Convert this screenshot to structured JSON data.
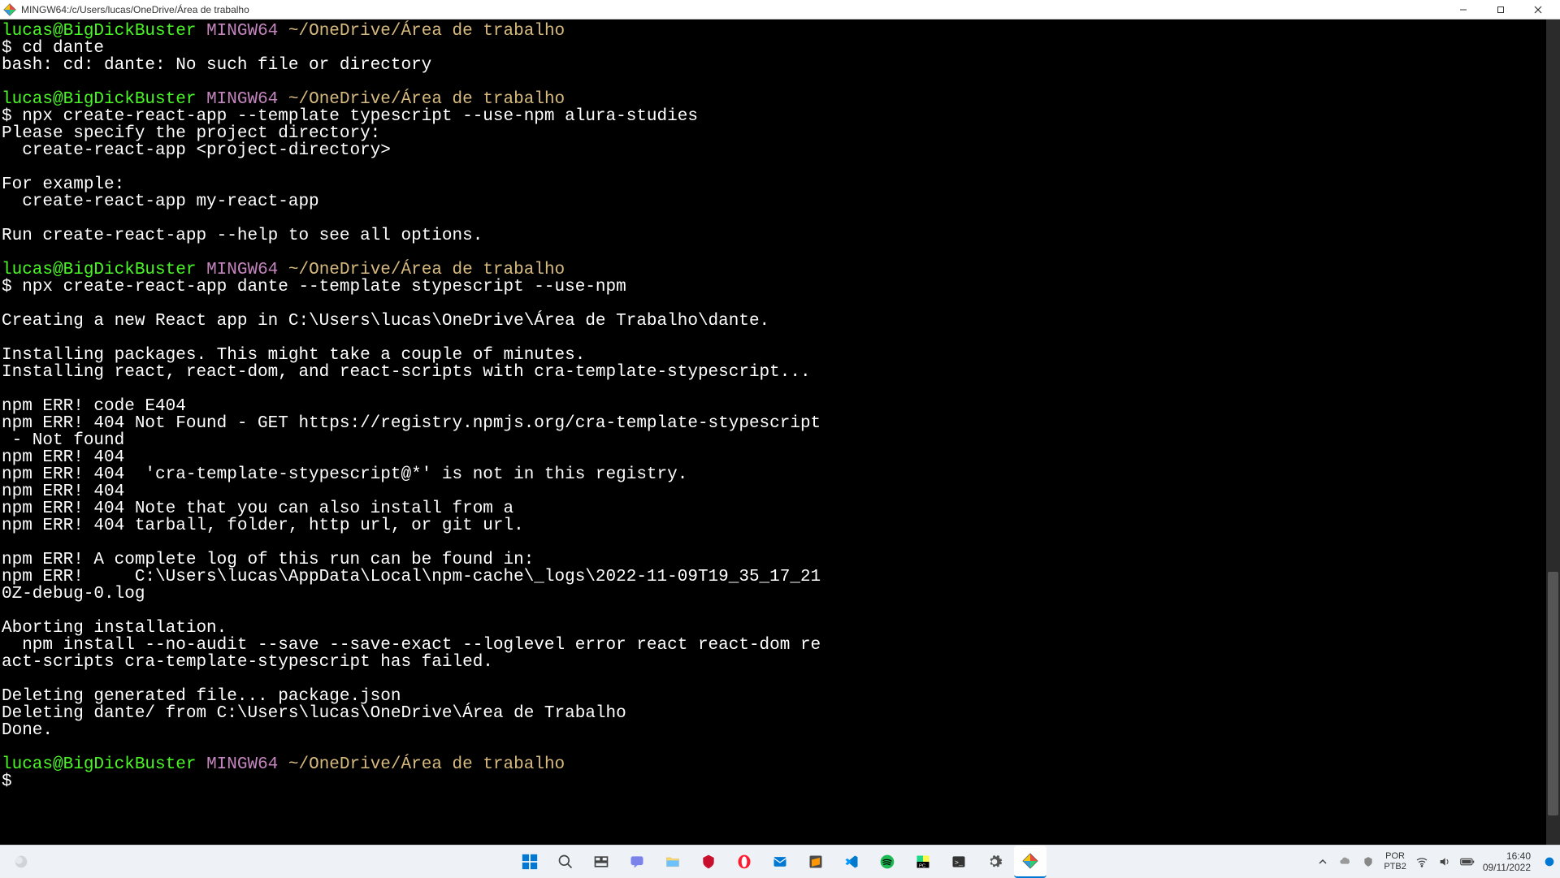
{
  "window": {
    "title": "MINGW64:/c/Users/lucas/OneDrive/Área de trabalho"
  },
  "prompt": {
    "user_host": "lucas@BigDickBuster",
    "shell": "MINGW64",
    "path": "~/OneDrive/Área de trabalho",
    "symbol": "$"
  },
  "terminal_lines": [
    {
      "type": "prompt"
    },
    {
      "type": "cmd",
      "text": "$ cd dante"
    },
    {
      "type": "out",
      "text": "bash: cd: dante: No such file or directory"
    },
    {
      "type": "blank"
    },
    {
      "type": "prompt"
    },
    {
      "type": "cmd",
      "text": "$ npx create-react-app --template typescript --use-npm alura-studies"
    },
    {
      "type": "out",
      "text": "Please specify the project directory:"
    },
    {
      "type": "out",
      "text": "  create-react-app <project-directory>"
    },
    {
      "type": "blank"
    },
    {
      "type": "out",
      "text": "For example:"
    },
    {
      "type": "out",
      "text": "  create-react-app my-react-app"
    },
    {
      "type": "blank"
    },
    {
      "type": "out",
      "text": "Run create-react-app --help to see all options."
    },
    {
      "type": "blank"
    },
    {
      "type": "prompt"
    },
    {
      "type": "cmd",
      "text": "$ npx create-react-app dante --template stypescript --use-npm"
    },
    {
      "type": "blank"
    },
    {
      "type": "out",
      "text": "Creating a new React app in C:\\Users\\lucas\\OneDrive\\Área de Trabalho\\dante."
    },
    {
      "type": "blank"
    },
    {
      "type": "out",
      "text": "Installing packages. This might take a couple of minutes."
    },
    {
      "type": "out",
      "text": "Installing react, react-dom, and react-scripts with cra-template-stypescript..."
    },
    {
      "type": "blank"
    },
    {
      "type": "out",
      "text": "npm ERR! code E404"
    },
    {
      "type": "out",
      "text": "npm ERR! 404 Not Found - GET https://registry.npmjs.org/cra-template-stypescript"
    },
    {
      "type": "out",
      "text": " - Not found"
    },
    {
      "type": "out",
      "text": "npm ERR! 404"
    },
    {
      "type": "out",
      "text": "npm ERR! 404  'cra-template-stypescript@*' is not in this registry."
    },
    {
      "type": "out",
      "text": "npm ERR! 404"
    },
    {
      "type": "out",
      "text": "npm ERR! 404 Note that you can also install from a"
    },
    {
      "type": "out",
      "text": "npm ERR! 404 tarball, folder, http url, or git url."
    },
    {
      "type": "blank"
    },
    {
      "type": "out",
      "text": "npm ERR! A complete log of this run can be found in:"
    },
    {
      "type": "out",
      "text": "npm ERR!     C:\\Users\\lucas\\AppData\\Local\\npm-cache\\_logs\\2022-11-09T19_35_17_21"
    },
    {
      "type": "out",
      "text": "0Z-debug-0.log"
    },
    {
      "type": "blank"
    },
    {
      "type": "out",
      "text": "Aborting installation."
    },
    {
      "type": "out",
      "text": "  npm install --no-audit --save --save-exact --loglevel error react react-dom re"
    },
    {
      "type": "out",
      "text": "act-scripts cra-template-stypescript has failed."
    },
    {
      "type": "blank"
    },
    {
      "type": "out",
      "text": "Deleting generated file... package.json"
    },
    {
      "type": "out",
      "text": "Deleting dante/ from C:\\Users\\lucas\\OneDrive\\Área de Trabalho"
    },
    {
      "type": "out",
      "text": "Done."
    },
    {
      "type": "blank"
    },
    {
      "type": "prompt"
    },
    {
      "type": "cmd",
      "text": "$"
    }
  ],
  "taskbar": {
    "lang_top": "POR",
    "lang_bottom": "PTB2",
    "time": "16:40",
    "date": "09/11/2022",
    "center_icons": [
      "start",
      "search",
      "task-view",
      "chat",
      "explorer",
      "mcafee",
      "opera",
      "mail",
      "sublime",
      "vscode",
      "spotify",
      "pycharm",
      "terminal",
      "settings",
      "git-bash"
    ]
  }
}
